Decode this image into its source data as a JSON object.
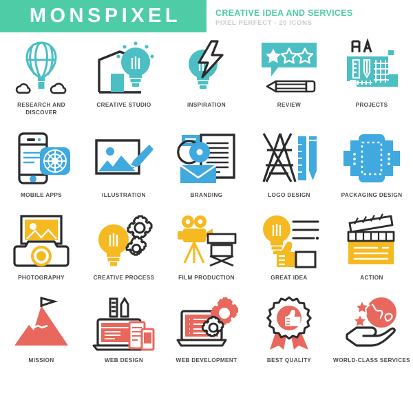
{
  "header": {
    "brand": "MONSPIXEL",
    "title": "CREATIVE IDEA AND SERVICES",
    "subtitle": "PIXEL PERFECT - 20 ICONS",
    "brand_band_color": "#4ECCA6",
    "title_color": "#4ECCA6",
    "subtitle_color": "#C9CBCC"
  },
  "palette": {
    "teal": "#4BBFC3",
    "blue": "#3FA9E0",
    "yellow": "#F5B921",
    "red": "#E8685D",
    "dark": "#2B2B2B",
    "label": "#4D4D4D",
    "white": "#FFFFFF"
  },
  "rows": [
    {
      "accent": "#4BBFC3",
      "cells": [
        {
          "label": "RESEARCH AND DISCOVER",
          "icon": "hot-air-balloon-icon"
        },
        {
          "label": "CREATIVE STUDIO",
          "icon": "lightbulb-house-icon"
        },
        {
          "label": "INSPIRATION",
          "icon": "lightbulb-lightning-icon"
        },
        {
          "label": "REVIEW",
          "icon": "speech-bubble-stars-pencil-icon"
        },
        {
          "label": "PROJECTS",
          "icon": "blueprint-icon"
        }
      ]
    },
    {
      "accent": "#3FA9E0",
      "cells": [
        {
          "label": "MOBILE APPS",
          "icon": "smartphone-compass-icon"
        },
        {
          "label": "ILLUSTRATION",
          "icon": "picture-brush-icon"
        },
        {
          "label": "BRANDING",
          "icon": "document-disc-envelope-icon"
        },
        {
          "label": "LOGO DESIGN",
          "icon": "letter-a-ruler-pencil-icon"
        },
        {
          "label": "PACKAGING DESIGN",
          "icon": "box-package-icon"
        }
      ]
    },
    {
      "accent": "#F5B921",
      "cells": [
        {
          "label": "PHOTOGRAPHY",
          "icon": "camera-photo-icon"
        },
        {
          "label": "CREATIVE PROCESS",
          "icon": "lightbulb-gears-icon"
        },
        {
          "label": "FILM PRODUCTION",
          "icon": "movie-camera-chair-icon"
        },
        {
          "label": "GREAT IDEA",
          "icon": "lightbulb-thumbsup-icon"
        },
        {
          "label": "ACTION",
          "icon": "clapperboard-icon"
        }
      ]
    },
    {
      "accent": "#E8685D",
      "cells": [
        {
          "label": "MISSION",
          "icon": "mountain-flag-icon"
        },
        {
          "label": "WEB DESIGN",
          "icon": "laptop-devices-ruler-icon"
        },
        {
          "label": "WEB DEVELOPMENT",
          "icon": "laptop-gears-icon"
        },
        {
          "label": "BEST QUALITY",
          "icon": "award-badge-thumbsup-icon"
        },
        {
          "label": "WORLD-CLASS SERVICES",
          "icon": "hand-globe-stars-icon"
        }
      ]
    }
  ]
}
